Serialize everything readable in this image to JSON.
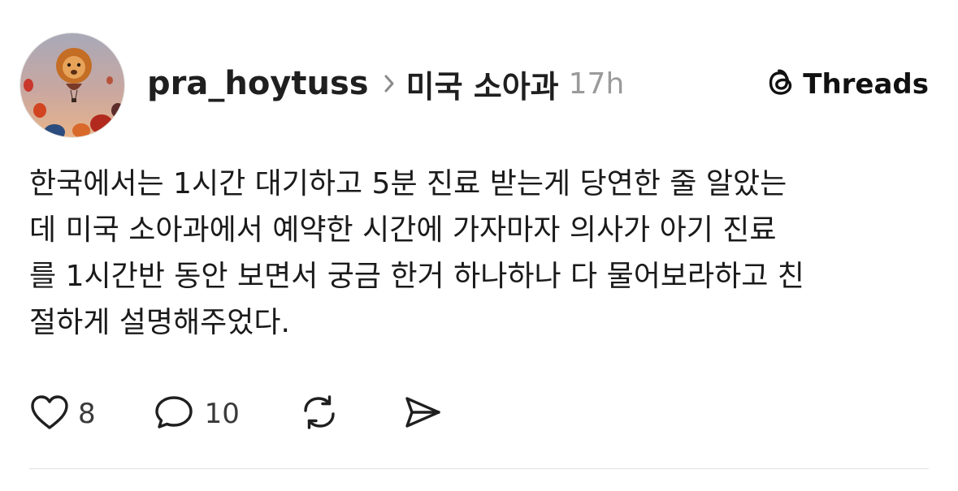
{
  "post": {
    "username": "pra_hoytuss",
    "community": "미국 소아과",
    "time_ago": "17h",
    "brand": "Threads",
    "text_lines": [
      "한국에서는 1시간 대기하고 5분 진료 받는게 당연한 줄 알았는",
      "데 미국 소아과에서 예약한 시간에 가자마자 의사가 아기 진료",
      "를 1시간반 동안 보면서 궁금 한거 하나하나 다 물어보라하고 친",
      "절하게 설명해주었다."
    ]
  },
  "actions": {
    "like_count": "8",
    "reply_count": "10"
  },
  "icons": {
    "avatar": "avatar-hot-air-balloons",
    "chevron": "chevron-right-icon",
    "brand": "threads-logo-icon",
    "like": "heart-icon",
    "reply": "comment-bubble-icon",
    "repost": "repost-icon",
    "share": "send-icon"
  },
  "colors": {
    "text": "#1a1a1a",
    "muted": "#9a9a9a",
    "divider": "#e2e2e2"
  }
}
